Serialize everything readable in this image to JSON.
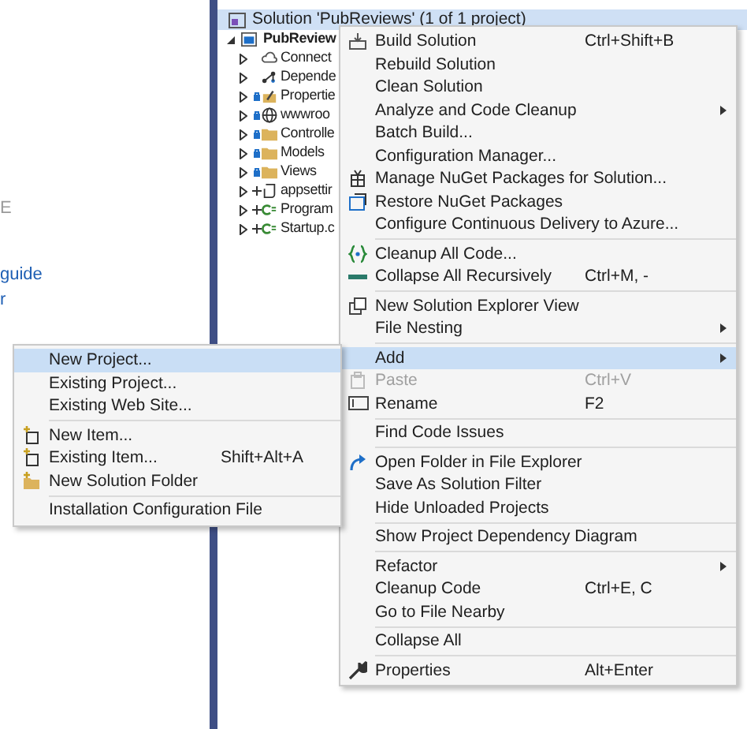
{
  "left_pane": {
    "fragments": [
      {
        "text": "E",
        "kind": "plain"
      },
      {
        "text": "guide",
        "kind": "link"
      },
      {
        "text": "r",
        "kind": "link"
      }
    ]
  },
  "solution_explorer": {
    "solution": {
      "label": "Solution 'PubReviews' (1 of 1 project)",
      "selected": true
    },
    "project": {
      "label": "PubReview",
      "expanded": true,
      "children": [
        {
          "label": "Connect",
          "kind": "connected",
          "expanded": false
        },
        {
          "label": "Depende",
          "kind": "dependencies",
          "expanded": false
        },
        {
          "label": "Propertie",
          "kind": "properties",
          "expanded": false
        },
        {
          "label": "wwwroo",
          "kind": "web",
          "expanded": false
        },
        {
          "label": "Controlle",
          "kind": "folder",
          "expanded": false
        },
        {
          "label": "Models",
          "kind": "folder",
          "expanded": false
        },
        {
          "label": "Views",
          "kind": "folder",
          "expanded": false
        },
        {
          "label": "appsettir",
          "kind": "json",
          "expanded": false
        },
        {
          "label": "Program",
          "kind": "csharp",
          "expanded": false
        },
        {
          "label": "Startup.c",
          "kind": "csharp",
          "expanded": false
        }
      ]
    }
  },
  "context_menu": {
    "items": [
      {
        "kind": "build",
        "label": "Build Solution",
        "shortcut": "Ctrl+Shift+B",
        "has_submenu": false,
        "disabled": false,
        "selected": false
      },
      {
        "kind": "plain",
        "label": "Rebuild Solution",
        "has_submenu": false,
        "disabled": false,
        "selected": false
      },
      {
        "kind": "plain",
        "label": "Clean Solution",
        "has_submenu": false,
        "disabled": false,
        "selected": false
      },
      {
        "kind": "plain",
        "label": "Analyze and Code Cleanup",
        "has_submenu": true,
        "disabled": false,
        "selected": false
      },
      {
        "kind": "plain",
        "label": "Batch Build...",
        "has_submenu": false,
        "disabled": false,
        "selected": false
      },
      {
        "kind": "plain",
        "label": "Configuration Manager...",
        "has_submenu": false,
        "disabled": false,
        "selected": false
      },
      {
        "kind": "nuget",
        "label": "Manage NuGet Packages for Solution...",
        "has_submenu": false,
        "disabled": false,
        "selected": false
      },
      {
        "kind": "restore",
        "label": "Restore NuGet Packages",
        "has_submenu": false,
        "disabled": false,
        "selected": false
      },
      {
        "kind": "plain",
        "label": "Configure Continuous Delivery to Azure...",
        "has_submenu": false,
        "disabled": false,
        "selected": false
      },
      {
        "kind": "separator"
      },
      {
        "kind": "cleanup",
        "label": "Cleanup All Code...",
        "has_submenu": false,
        "disabled": false,
        "selected": false
      },
      {
        "kind": "collapse",
        "label": "Collapse All Recursively",
        "shortcut": "Ctrl+M, -",
        "has_submenu": false,
        "disabled": false,
        "selected": false
      },
      {
        "kind": "separator"
      },
      {
        "kind": "view",
        "label": "New Solution Explorer View",
        "has_submenu": false,
        "disabled": false,
        "selected": false
      },
      {
        "kind": "plain",
        "label": "File Nesting",
        "has_submenu": true,
        "disabled": false,
        "selected": false
      },
      {
        "kind": "separator"
      },
      {
        "kind": "plain",
        "label": "Add",
        "has_submenu": true,
        "disabled": false,
        "selected": true
      },
      {
        "kind": "paste",
        "label": "Paste",
        "shortcut": "Ctrl+V",
        "has_submenu": false,
        "disabled": true,
        "selected": false
      },
      {
        "kind": "rename",
        "label": "Rename",
        "shortcut": "F2",
        "has_submenu": false,
        "disabled": false,
        "selected": false
      },
      {
        "kind": "separator"
      },
      {
        "kind": "plain",
        "label": "Find Code Issues",
        "has_submenu": false,
        "disabled": false,
        "selected": false
      },
      {
        "kind": "separator"
      },
      {
        "kind": "open",
        "label": "Open Folder in File Explorer",
        "has_submenu": false,
        "disabled": false,
        "selected": false
      },
      {
        "kind": "plain",
        "label": "Save As Solution Filter",
        "has_submenu": false,
        "disabled": false,
        "selected": false
      },
      {
        "kind": "plain",
        "label": "Hide Unloaded Projects",
        "has_submenu": false,
        "disabled": false,
        "selected": false
      },
      {
        "kind": "separator"
      },
      {
        "kind": "plain",
        "label": "Show Project Dependency Diagram",
        "has_submenu": false,
        "disabled": false,
        "selected": false
      },
      {
        "kind": "separator"
      },
      {
        "kind": "plain",
        "label": "Refactor",
        "has_submenu": true,
        "disabled": false,
        "selected": false
      },
      {
        "kind": "plain",
        "label": "Cleanup Code",
        "shortcut": "Ctrl+E, C",
        "has_submenu": false,
        "disabled": false,
        "selected": false
      },
      {
        "kind": "plain",
        "label": "Go to File Nearby",
        "has_submenu": false,
        "disabled": false,
        "selected": false
      },
      {
        "kind": "separator"
      },
      {
        "kind": "plain",
        "label": "Collapse All",
        "has_submenu": false,
        "disabled": false,
        "selected": false
      },
      {
        "kind": "separator"
      },
      {
        "kind": "properties",
        "label": "Properties",
        "shortcut": "Alt+Enter",
        "has_submenu": false,
        "disabled": false,
        "selected": false
      }
    ]
  },
  "add_submenu": {
    "items": [
      {
        "kind": "plain",
        "label": "New Project...",
        "has_submenu": false,
        "disabled": false,
        "selected": true
      },
      {
        "kind": "plain",
        "label": "Existing Project...",
        "has_submenu": false,
        "disabled": false,
        "selected": false
      },
      {
        "kind": "plain",
        "label": "Existing Web Site...",
        "has_submenu": false,
        "disabled": false,
        "selected": false
      },
      {
        "kind": "separator"
      },
      {
        "kind": "newitem",
        "label": "New Item...",
        "has_submenu": false,
        "disabled": false,
        "selected": false
      },
      {
        "kind": "newitem",
        "label": "Existing Item...",
        "shortcut": "Shift+Alt+A",
        "has_submenu": false,
        "disabled": false,
        "selected": false
      },
      {
        "kind": "newfolder",
        "label": "New Solution Folder",
        "has_submenu": false,
        "disabled": false,
        "selected": false
      },
      {
        "kind": "separator"
      },
      {
        "kind": "plain",
        "label": "Installation Configuration File",
        "has_submenu": false,
        "disabled": false,
        "selected": false
      }
    ]
  }
}
